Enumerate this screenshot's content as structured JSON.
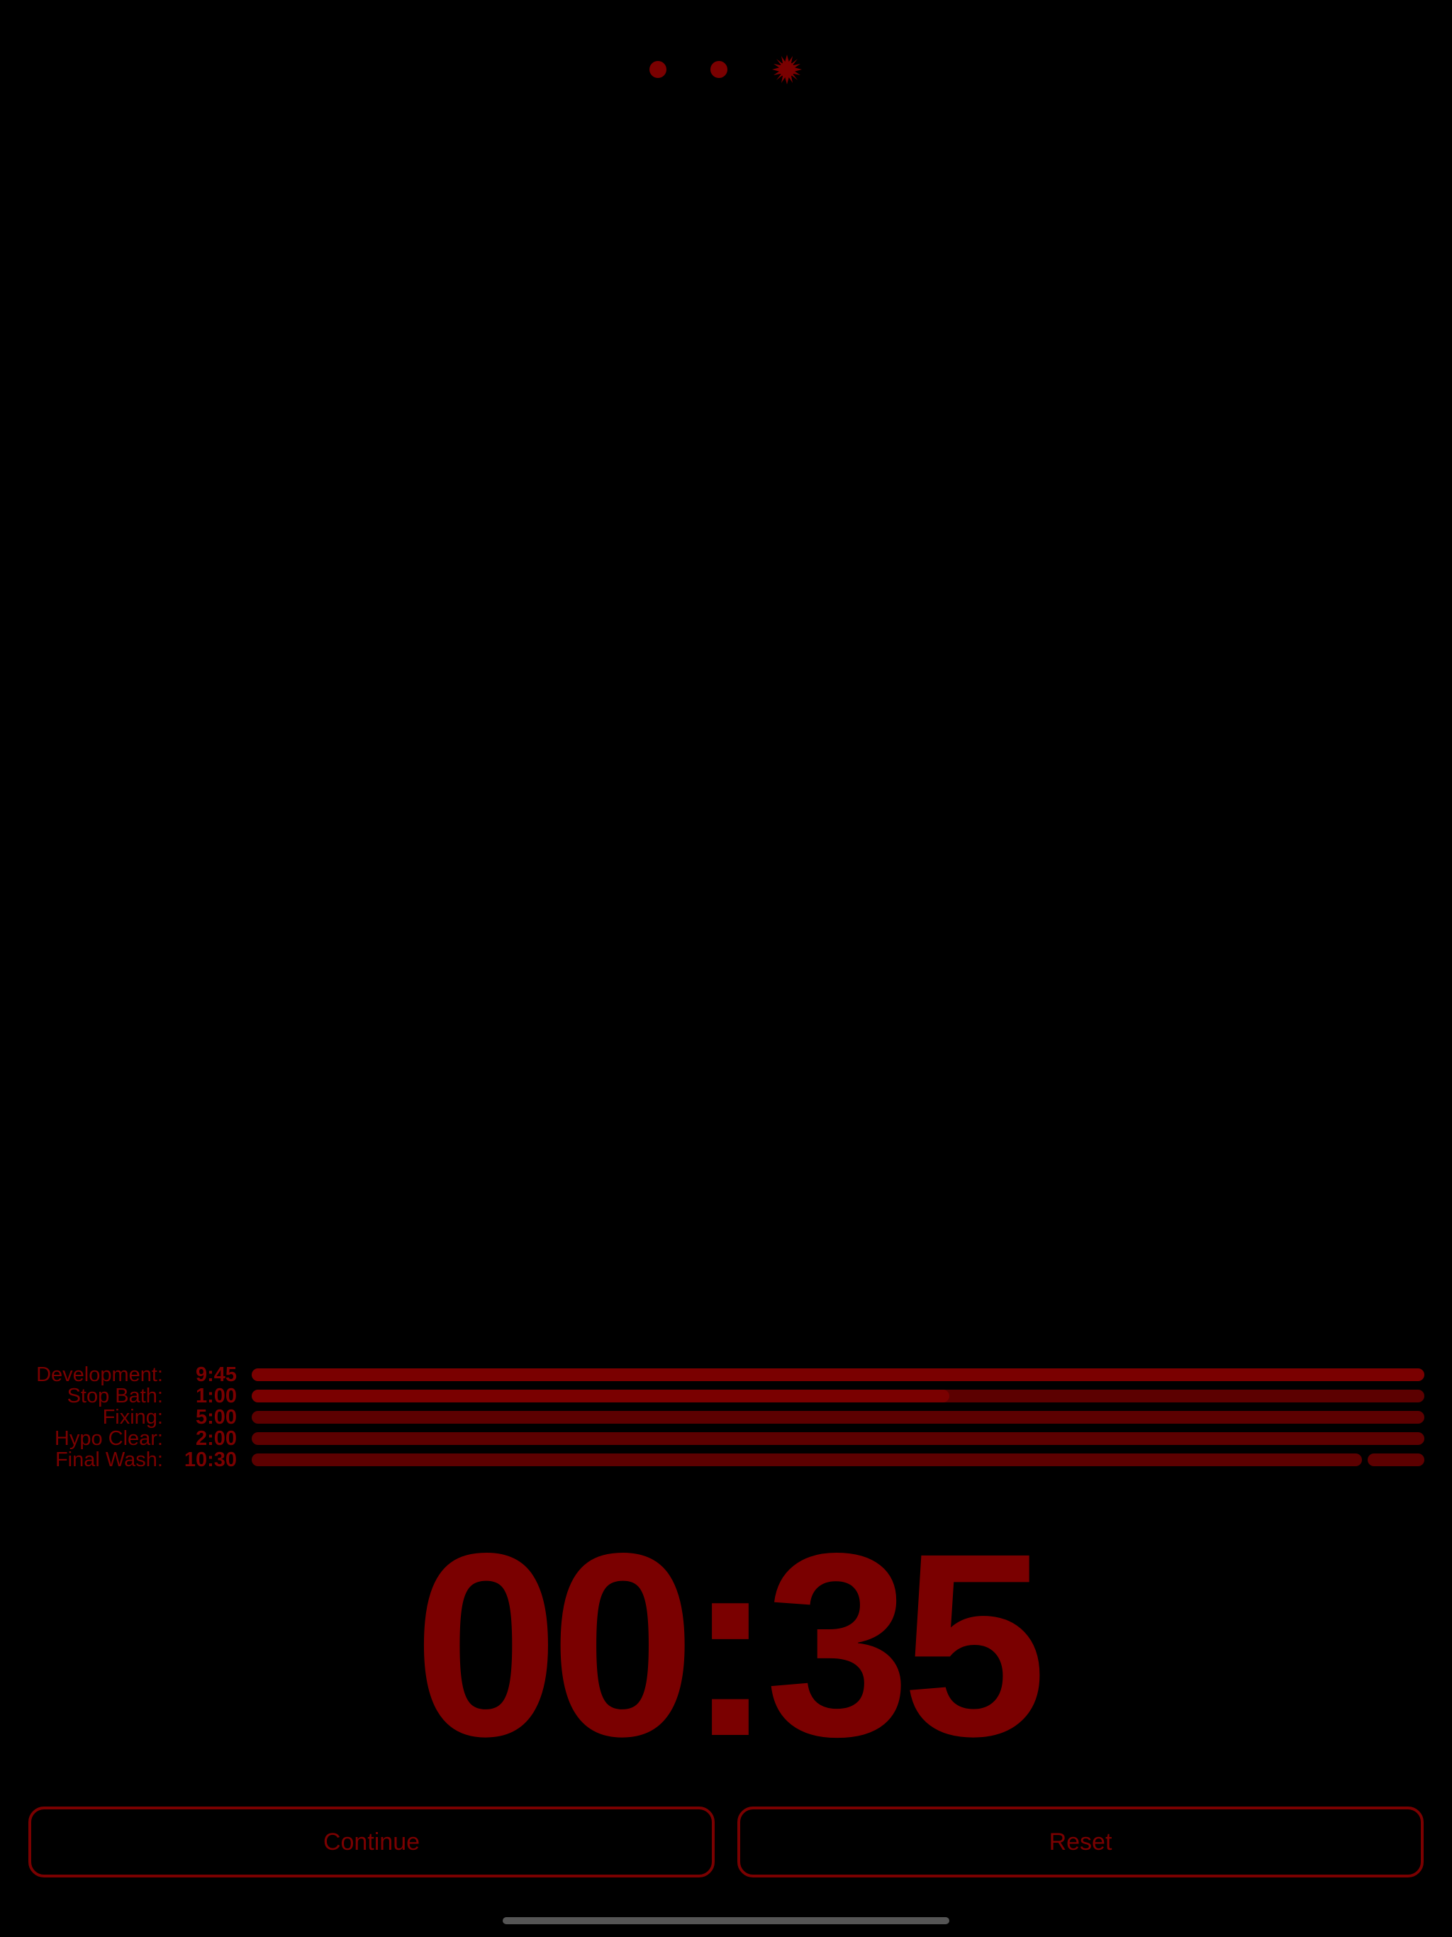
{
  "page_indicator": {
    "pages": [
      "dot",
      "dot",
      "gear-icon"
    ],
    "active_color": "#7a0000"
  },
  "steps": [
    {
      "name": "Development:",
      "time": "9:45",
      "progress": 1.0
    },
    {
      "name": "Stop Bath:",
      "time": "1:00",
      "progress": 0.595
    },
    {
      "name": "Fixing:",
      "time": "5:00",
      "progress": 0.0
    },
    {
      "name": "Hypo Clear:",
      "time": "2:00",
      "progress": 0.0
    },
    {
      "name": "Final Wash:",
      "time": "10:30",
      "progress": 0.0,
      "segmented": true
    }
  ],
  "timer": {
    "value": "00:35"
  },
  "buttons": {
    "continue_label": "Continue",
    "reset_label": "Reset"
  },
  "colors": {
    "background": "#000000",
    "accent": "#7a0000",
    "track": "#5c0000"
  }
}
